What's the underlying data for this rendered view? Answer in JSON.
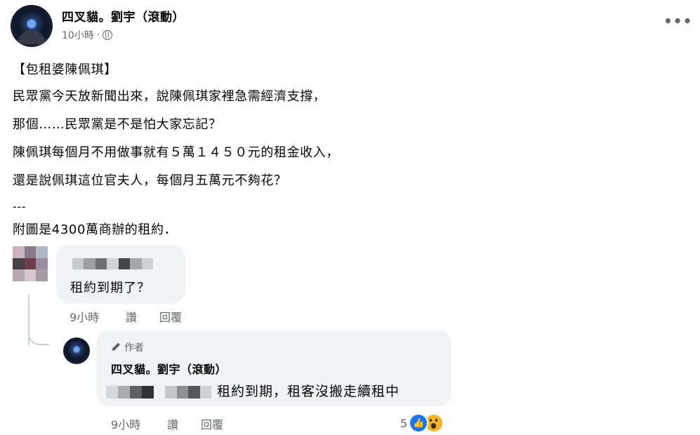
{
  "post": {
    "author": "四叉貓。劉宇（滾動）",
    "time": "10小時",
    "time_separator": "·",
    "lines": [
      "【包租婆陳佩琪】",
      "民眾黨今天放新聞出來，說陳佩琪家裡急需經濟支撐，",
      "那個……民眾黨是不是怕大家忘記？",
      "陳佩琪每個月不用做事就有５萬１４５０元的租金收入，",
      "還是說佩琪這位官夫人，每個月五萬元不夠花？",
      "---",
      "附圖是4300萬商辦的租約．"
    ],
    "more_label": "•••"
  },
  "comment": {
    "text": "租約到期了？",
    "time": "9小時",
    "like_label": "讚",
    "reply_label": "回覆"
  },
  "reply": {
    "tag": "作者",
    "author": "四叉貓。劉宇（滾動）",
    "text": "租約到期，租客沒搬走續租中",
    "time": "9小時",
    "like_label": "讚",
    "reply_label": "回覆",
    "reaction_count": "5",
    "like_glyph": "👍"
  },
  "colors": {
    "secondary_text": "#65676b",
    "bubble": "#f0f2f5",
    "like_blue": "#1877f2",
    "wow_yellow": "#f7b125"
  }
}
